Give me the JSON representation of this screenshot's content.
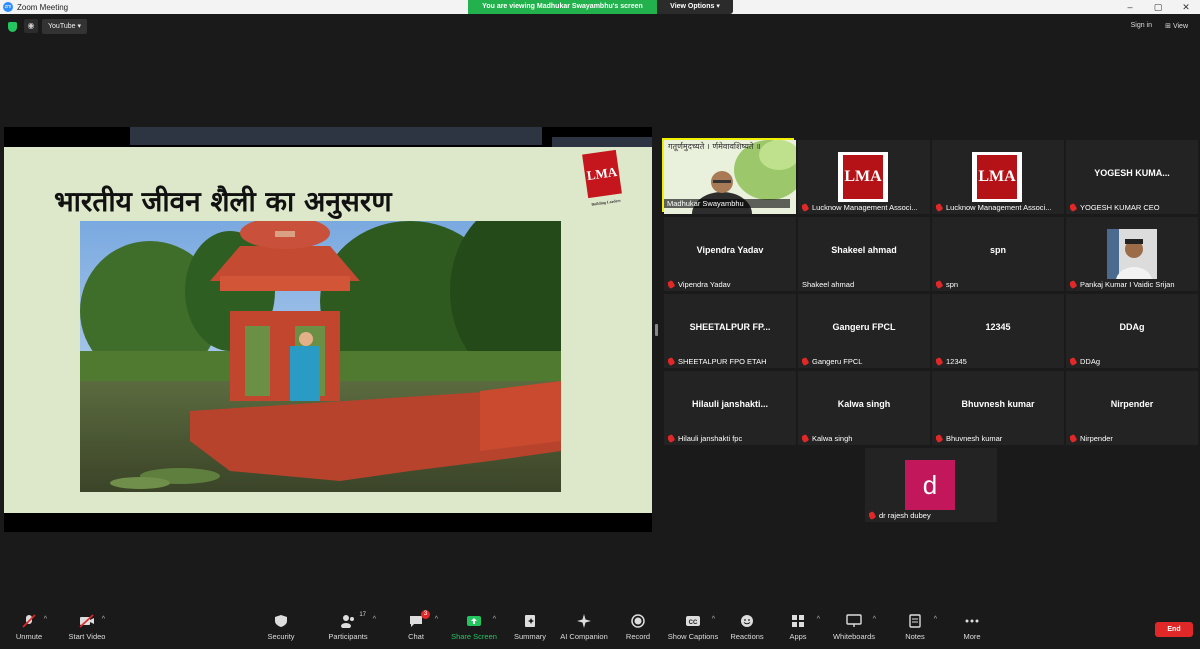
{
  "window": {
    "title": "Zoom Meeting",
    "controls": [
      "–",
      "▢",
      "✕"
    ]
  },
  "share_banner": {
    "message": "You are viewing Madhukar Swayambhu's screen",
    "options_label": "View Options",
    "options_caret": "▾"
  },
  "top_toolbar": {
    "source_select": "YouTube ▾",
    "signin_label": "Sign in",
    "view_label": "⊞ View"
  },
  "slide": {
    "heading": "भारतीय जीवन शैली का अनुसरण",
    "logo_text": "LMA",
    "logo_caption": "Building Leaders"
  },
  "participants": [
    {
      "name": "",
      "label": "Madhukar Swayambhu",
      "muted": false,
      "active": true,
      "kind": "video"
    },
    {
      "name": "",
      "label": "Lucknow Management Associ...",
      "muted": true,
      "kind": "lma"
    },
    {
      "name": "",
      "label": "Lucknow Management Associ...",
      "muted": true,
      "kind": "lma"
    },
    {
      "name": "YOGESH KUMA...",
      "label": "YOGESH KUMAR CEO",
      "muted": true,
      "kind": "text"
    },
    {
      "name": "Vipendra Yadav",
      "label": "Vipendra Yadav",
      "muted": true,
      "kind": "text"
    },
    {
      "name": "Shakeel ahmad",
      "label": "Shakeel ahmad",
      "muted": false,
      "kind": "text"
    },
    {
      "name": "spn",
      "label": "spn",
      "muted": true,
      "kind": "text"
    },
    {
      "name": "",
      "label": "Pankaj Kumar I Vaidic Srijan",
      "muted": true,
      "kind": "photo"
    },
    {
      "name": "SHEETALPUR FP...",
      "label": "SHEETALPUR FPO ETAH",
      "muted": true,
      "kind": "text"
    },
    {
      "name": "Gangeru FPCL",
      "label": "Gangeru FPCL",
      "muted": true,
      "kind": "text"
    },
    {
      "name": "12345",
      "label": "12345",
      "muted": true,
      "kind": "text"
    },
    {
      "name": "DDAg",
      "label": "DDAg",
      "muted": true,
      "kind": "text"
    },
    {
      "name": "Hilauli janshakti...",
      "label": "Hilauli janshakti fpc",
      "muted": true,
      "kind": "text"
    },
    {
      "name": "Kalwa singh",
      "label": "Kalwa singh",
      "muted": true,
      "kind": "text"
    },
    {
      "name": "Bhuvnesh kumar",
      "label": "Bhuvnesh kumar",
      "muted": true,
      "kind": "text"
    },
    {
      "name": "Nirpender",
      "label": "Nirpender",
      "muted": true,
      "kind": "text"
    },
    {
      "name": "",
      "label": "dr rajesh dubey",
      "muted": true,
      "kind": "avatar",
      "avatar_letter": "d"
    }
  ],
  "video_overlay_text": "गतूर्णमुदच्यते । र्णमेवावशिष्यते ॥",
  "bottom_toolbar": {
    "unmute": "Unmute",
    "start_video": "Start Video",
    "security": "Security",
    "participants": "Participants",
    "participants_count": "17",
    "chat": "Chat",
    "chat_badge": "3",
    "share_screen": "Share Screen",
    "summary": "Summary",
    "ai_companion": "AI Companion",
    "record": "Record",
    "show_captions": "Show Captions",
    "reactions": "Reactions",
    "apps": "Apps",
    "whiteboards": "Whiteboards",
    "notes": "Notes",
    "more": "More",
    "end": "End"
  },
  "colors": {
    "banner_green": "#22b14c",
    "end_red": "#e02828",
    "slide_bg": "#dde8cb",
    "active_speaker": "#f0f000"
  }
}
